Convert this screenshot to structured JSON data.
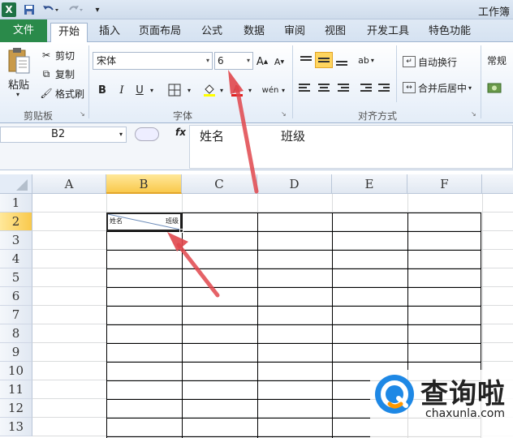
{
  "titlebar": {
    "app_logo": "X",
    "title": "工作簿",
    "icons": [
      "excel-logo-icon",
      "save-icon",
      "undo-icon",
      "redo-icon",
      "customize-quick-access-icon"
    ]
  },
  "tabs": [
    "文件",
    "开始",
    "插入",
    "页面布局",
    "公式",
    "数据",
    "审阅",
    "视图",
    "开发工具",
    "特色功能"
  ],
  "ribbon": {
    "clipboard": {
      "paste": "粘贴",
      "cut": "剪切",
      "copy": "复制",
      "format_painter": "格式刷",
      "group_label": "剪贴板"
    },
    "font": {
      "font_name": "宋体",
      "font_size": "6",
      "group_label": "字体",
      "bold": "B",
      "italic": "I",
      "underline": "U",
      "phonetic": "wén"
    },
    "alignment": {
      "wrap_text": "自动换行",
      "merge_center": "合并后居中",
      "group_label": "对齐方式"
    },
    "number": {
      "format": "常规"
    }
  },
  "formula_bar": {
    "name_box": "B2",
    "fx": "fx",
    "content_name": "姓名",
    "content_class": "班级"
  },
  "grid": {
    "columns": [
      "A",
      "B",
      "C",
      "D",
      "E",
      "F"
    ],
    "rows": [
      "1",
      "2",
      "3",
      "4",
      "5",
      "6",
      "7",
      "8",
      "9",
      "10",
      "11",
      "12",
      "13"
    ],
    "selected_cell": "B2",
    "b2_left_text": "姓名",
    "b2_right_text": "班级"
  },
  "watermark": {
    "name": "查询啦",
    "url": "chaxunla.com"
  },
  "colors": {
    "file_tab": "#2a8a4a",
    "selected_header": "#f9c94c",
    "arrow": "#e0474c",
    "watermark_logo": "#1e88e5"
  }
}
